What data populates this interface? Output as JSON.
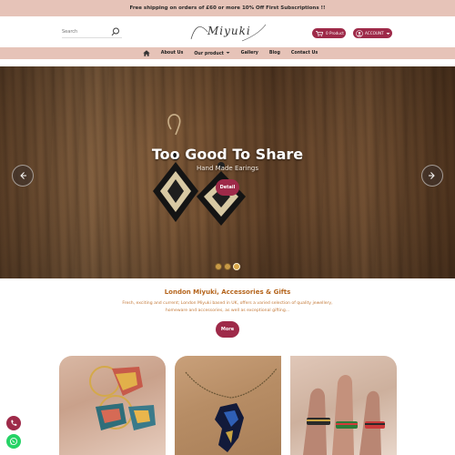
{
  "announcement": "Free shipping on orders of £60 or more 10% Off First Subscriptions !!",
  "header": {
    "search_placeholder": "Search",
    "logo_text": "Miyuki",
    "cart_label": "0 Product",
    "account_label": "ACCOUNT"
  },
  "nav": {
    "items": [
      "About Us",
      "Our product",
      "Gallery",
      "Blog",
      "Contact Us"
    ]
  },
  "hero": {
    "title": "Too Good To Share",
    "subtitle": "Hand Made Earings",
    "button": "Detail"
  },
  "intro": {
    "title": "London Miyuki, Accessories & Gifts",
    "text": "Fresh, exciting and current; London Miyuki based in UK, offers a varied selection of quality jewellery, homeware and accessories, as well as exceptional gifting...",
    "button": "More"
  },
  "colors": {
    "brand": "#9e2a49",
    "bar": "#e6c3b8",
    "intro_title": "#b5651d"
  },
  "icons": {
    "search": "search-icon",
    "cart": "cart-icon",
    "account": "user-icon",
    "home": "home-icon",
    "prev": "chevron-left-icon",
    "next": "chevron-right-icon",
    "phone": "phone-icon",
    "whatsapp": "whatsapp-icon"
  }
}
